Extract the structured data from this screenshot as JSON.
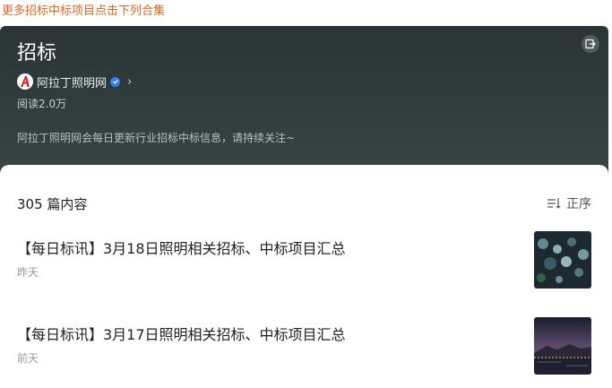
{
  "top_link": "更多招标中标项目点击下列合集",
  "collection": {
    "title": "招标",
    "publisher": "阿拉丁照明网",
    "reads": "阅读2.0万",
    "description": "阿拉丁照明网会每日更新行业招标中标信息，请持续关注~"
  },
  "list": {
    "count_label": "305 篇内容",
    "sort_label": "正序",
    "items": [
      {
        "title": "【每日标讯】3月18日照明相关招标、中标项目汇总",
        "date": "昨天",
        "thumb": "bokeh-lights-image"
      },
      {
        "title": "【每日标讯】3月17日照明相关招标、中标项目汇总",
        "date": "前天",
        "thumb": "night-lake-image"
      }
    ]
  },
  "colors": {
    "link": "#e0651f",
    "header_bg": "#2f3b3b",
    "verified": "#2f7ef5",
    "logo_red": "#d8232a"
  },
  "icons": [
    "exit-icon",
    "publisher-logo-icon",
    "verified-icon",
    "chevron-right-icon",
    "sort-icon"
  ]
}
